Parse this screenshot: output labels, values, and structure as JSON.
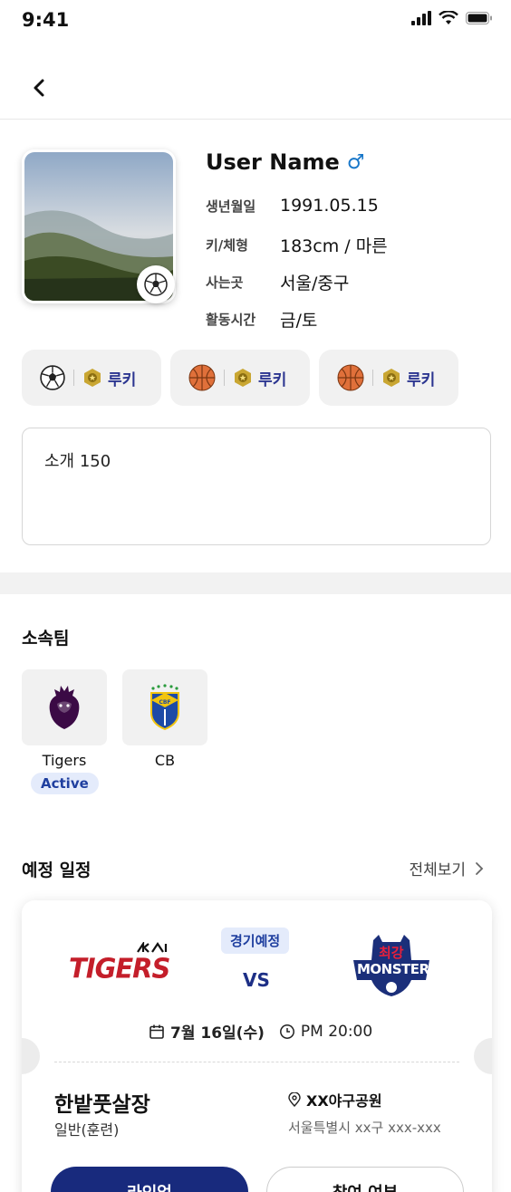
{
  "status_bar": {
    "time": "9:41"
  },
  "profile": {
    "name": "User Name",
    "gender_symbol": "♂",
    "info": [
      {
        "label": "생년월일",
        "value": "1991.05.15"
      },
      {
        "label": "키/체형",
        "value": "183cm / 마른"
      },
      {
        "label": "사는곳",
        "value": "서울/중구"
      },
      {
        "label": "활동시간",
        "value": "금/토"
      }
    ],
    "sport_chips": [
      {
        "sport_icon": "soccer-ball-icon",
        "level_icon": "rookie-badge-icon",
        "level": "루키"
      },
      {
        "sport_icon": "basketball-icon",
        "level_icon": "rookie-badge-icon",
        "level": "루키"
      },
      {
        "sport_icon": "basketball-icon",
        "level_icon": "rookie-badge-icon",
        "level": "루키"
      }
    ],
    "intro_text": "소개 150"
  },
  "teams_section": {
    "title": "소속팀",
    "teams": [
      {
        "name": "Tigers",
        "badge": "Active",
        "logo": "lion-crest-icon"
      },
      {
        "name": "CB",
        "badge": "",
        "logo": "brazil-crest-icon"
      }
    ]
  },
  "schedule_section": {
    "title": "예정 일정",
    "view_all": "전체보기",
    "card": {
      "status": "경기예정",
      "home_team_logo": "TIGERS",
      "vs": "VS",
      "away_team_logo_top": "최강",
      "away_team_logo": "MONSTERS",
      "date": "7월 16일(수)",
      "time": "PM 20:00",
      "venue_name": "한밭풋살장",
      "venue_type": "일반(훈련)",
      "place_name": "XX야구공원",
      "place_address": "서울특별시 xx구 xxx-xxx",
      "primary_button": "라인업",
      "secondary_button": "참여 여부"
    }
  },
  "colors": {
    "accent_navy": "#182a7d",
    "badge_bg": "#e4ebfb",
    "gender_blue": "#1877c9",
    "chip_bg": "#f1f1f1"
  }
}
